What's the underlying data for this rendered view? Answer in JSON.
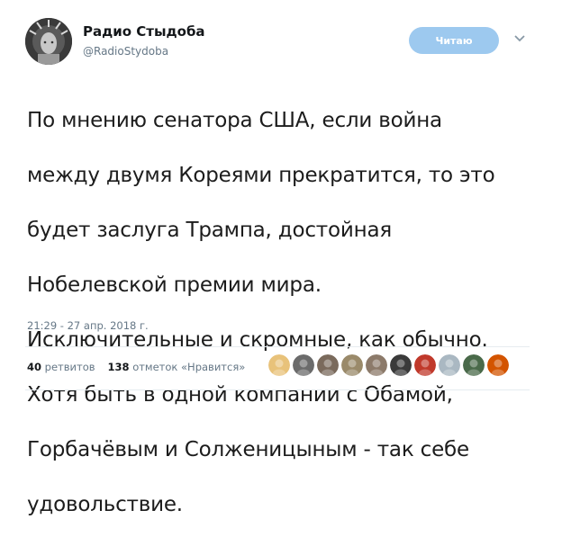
{
  "author": {
    "display_name": "Радио Стыдоба",
    "handle": "@RadioStydoba",
    "avatar_icon": "statue-of-liberty-avatar"
  },
  "follow_button": {
    "label": "Читаю",
    "color": "#9dc9ef"
  },
  "menu_icon": "chevron-down-icon",
  "tweet": {
    "text_lines": [
      "По мнению сенатора США, если война",
      "между двумя Кореями прекратится, то это",
      "будет заслуга Трампа, достойная",
      "Нобелевской премии мира.",
      "Исключительные и скромные, как обычно.",
      "Хотя быть в одной компании с Обамой,",
      "Горбачёвым и Солженицыным - так себе",
      "удовольствие."
    ],
    "timestamp": "21:29 - 27 апр. 2018 г."
  },
  "stats": {
    "retweets_count": "40",
    "retweets_label": "ретвитов",
    "likes_count": "138",
    "likes_label": "отметок «Нравится»"
  },
  "liker_avatars": [
    {
      "icon": "cartoon-girl-avatar",
      "color": "#e8c27a"
    },
    {
      "icon": "landscape-avatar",
      "color": "#6b6b6b"
    },
    {
      "icon": "portrait-avatar",
      "color": "#7a6a5c"
    },
    {
      "icon": "soldier-avatar",
      "color": "#9a8a6a"
    },
    {
      "icon": "photo-avatar",
      "color": "#8c7a6a"
    },
    {
      "icon": "robot-avatar",
      "color": "#3a3a3a"
    },
    {
      "icon": "hammer-sickle-avatar",
      "color": "#c0392b"
    },
    {
      "icon": "default-avatar",
      "color": "#aab8c2"
    },
    {
      "icon": "car-avatar",
      "color": "#4a6a4a"
    },
    {
      "icon": "orange-avatar",
      "color": "#d35400"
    }
  ]
}
